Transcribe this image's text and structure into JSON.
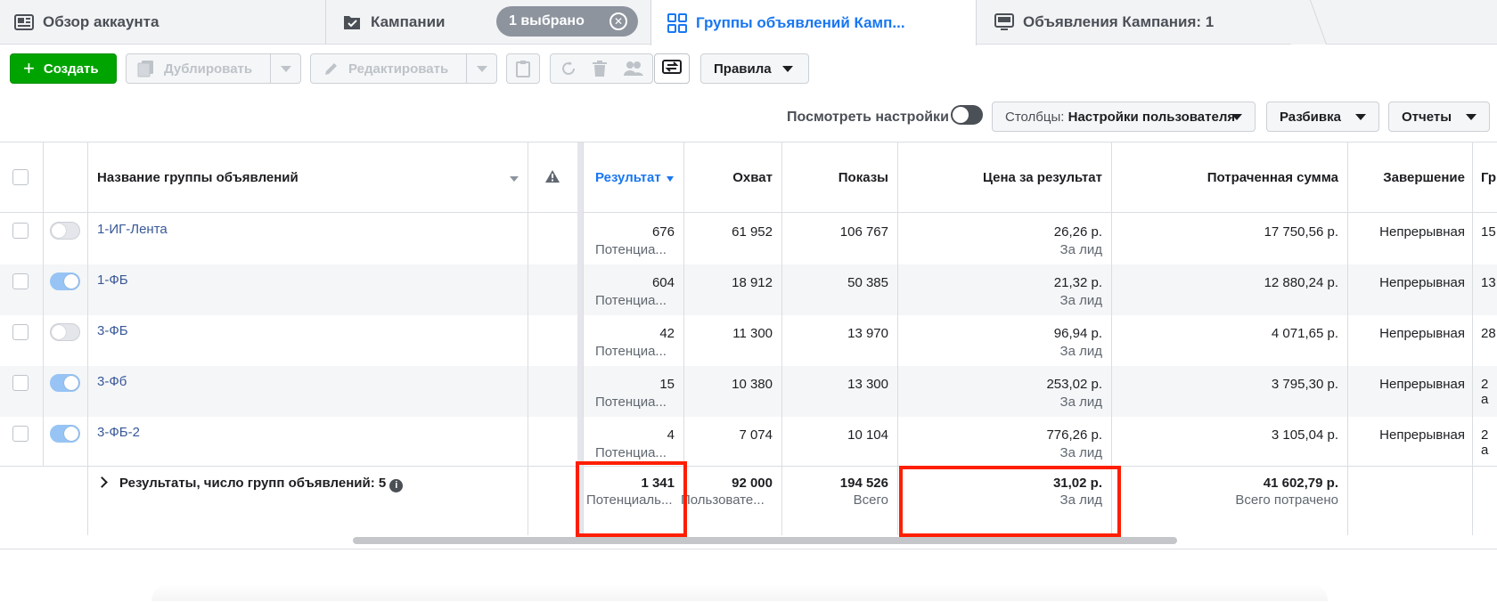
{
  "tabs": [
    {
      "label": "Обзор аккаунта",
      "icon": "account-overview-icon"
    },
    {
      "label": "Кампании",
      "icon": "campaigns-checkbox-icon"
    },
    {
      "label": "Группы объявлений Камп...",
      "icon": "adsets-grid-icon"
    },
    {
      "label": "Объявления Кампания: 1",
      "icon": "ads-monitor-icon"
    }
  ],
  "selected_pill": {
    "label": "1 выбрано",
    "close": "✕"
  },
  "toolbar": {
    "create_label": "Создать",
    "duplicate_label": "Дублировать",
    "edit_label": "Редактировать",
    "rules_label": "Правила"
  },
  "settings": {
    "view_settings_label": "Посмотреть настройки",
    "columns_prefix": "Столбцы:",
    "columns_value": "Настройки пользователя",
    "breakdown_label": "Разбивка",
    "reports_label": "Отчеты"
  },
  "table": {
    "headers": {
      "name": "Название группы объявлений",
      "results": "Результат",
      "reach": "Охват",
      "impressions": "Показы",
      "cost_per_result": "Цена за результат",
      "amount_spent": "Потраченная сумма",
      "ends": "Завершение",
      "schedule": "Гр"
    },
    "rows": [
      {
        "name": "1-ИГ-Лента",
        "on": false,
        "results": "676",
        "results_sub": "Потенциа...",
        "reach": "61 952",
        "impressions": "106 767",
        "cpr": "26,26 р.",
        "cpr_sub": "За лид",
        "spent": "17 750,56 р.",
        "ends": "Непрерывная",
        "sched": "15"
      },
      {
        "name": "1-ФБ",
        "on": true,
        "results": "604",
        "results_sub": "Потенциа...",
        "reach": "18 912",
        "impressions": "50 385",
        "cpr": "21,32 р.",
        "cpr_sub": "За лид",
        "spent": "12 880,24 р.",
        "ends": "Непрерывная",
        "sched": "13"
      },
      {
        "name": "3-ФБ",
        "on": false,
        "results": "42",
        "results_sub": "Потенциа...",
        "reach": "11 300",
        "impressions": "13 970",
        "cpr": "96,94 р.",
        "cpr_sub": "За лид",
        "spent": "4 071,65 р.",
        "ends": "Непрерывная",
        "sched": "28"
      },
      {
        "name": "3-Фб",
        "on": true,
        "results": "15",
        "results_sub": "Потенциа...",
        "reach": "10 380",
        "impressions": "13 300",
        "cpr": "253,02 р.",
        "cpr_sub": "За лид",
        "spent": "3 795,30 р.",
        "ends": "Непрерывная",
        "sched": "2 а"
      },
      {
        "name": "3-ФБ-2",
        "on": true,
        "results": "4",
        "results_sub": "Потенциа...",
        "reach": "7 074",
        "impressions": "10 104",
        "cpr": "776,26 р.",
        "cpr_sub": "За лид",
        "spent": "3 105,04 р.",
        "ends": "Непрерывная",
        "sched": "2 а"
      }
    ],
    "summary": {
      "title": "Результаты, число групп объявлений: 5",
      "info": "i",
      "results": "1 341",
      "results_sub": "Потенциаль...",
      "reach": "92 000",
      "reach_sub": "Пользовате...",
      "impressions": "194 526",
      "impressions_sub": "Всего",
      "cpr": "31,02 р.",
      "cpr_sub": "За лид",
      "spent": "41 602,79 р.",
      "spent_sub": "Всего потрачено"
    }
  },
  "colors": {
    "accent": "#1877f2",
    "create": "#00a400",
    "highlight": "#ff1e00",
    "link": "#385898"
  }
}
